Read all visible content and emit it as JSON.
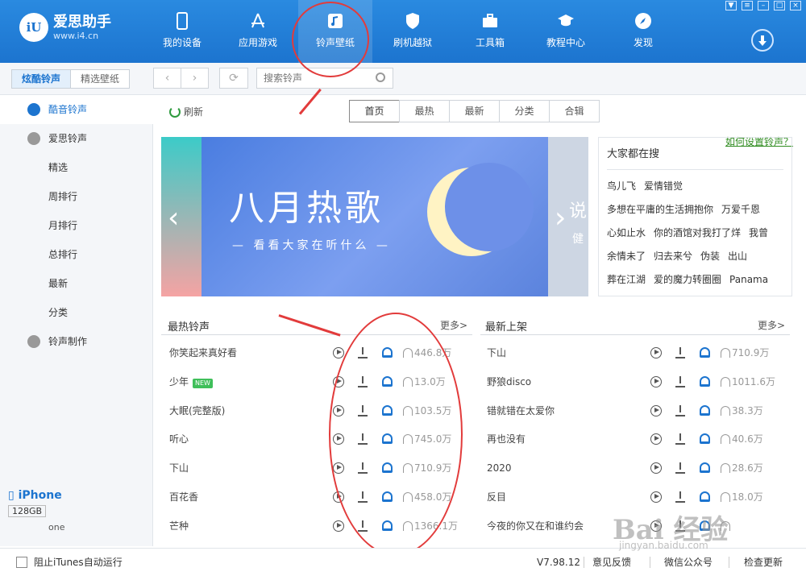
{
  "app": {
    "name": "爱思助手",
    "url": "www.i4.cn",
    "logo_text": "iU"
  },
  "nav": [
    {
      "label": "我的设备",
      "icon": "phone-icon"
    },
    {
      "label": "应用游戏",
      "icon": "app-store-icon"
    },
    {
      "label": "铃声壁纸",
      "icon": "music-note-icon"
    },
    {
      "label": "刷机越狱",
      "icon": "shield-icon"
    },
    {
      "label": "工具箱",
      "icon": "toolbox-icon"
    },
    {
      "label": "教程中心",
      "icon": "graduation-cap-icon"
    },
    {
      "label": "发现",
      "icon": "compass-icon"
    }
  ],
  "nav_active_index": 2,
  "toolbar": {
    "seg_ringtone": "炫酷铃声",
    "seg_wallpaper": "精选壁纸",
    "search_placeholder": "搜索铃声",
    "howto": "如何设置铃声？"
  },
  "sidebar": {
    "items": [
      "酷音铃声",
      "爱思铃声",
      "精选",
      "周排行",
      "月排行",
      "总排行",
      "最新",
      "分类",
      "铃声制作"
    ]
  },
  "device": {
    "name": "iPhone",
    "capacity": "128GB",
    "sub": "one"
  },
  "content": {
    "refresh": "刷新",
    "tabs": [
      "首页",
      "最热",
      "最新",
      "分类",
      "合辑"
    ],
    "banner": {
      "title": "八月热歌",
      "subtitle": "— 看看大家在听什么 —",
      "side_text_1": "说",
      "side_text_2": "健"
    },
    "trending": {
      "title": "大家都在搜",
      "tags": [
        "鸟儿飞",
        "爱情错觉",
        "多想在平庸的生活拥抱你",
        "万爱千恩",
        "心如止水",
        "你的酒馆对我打了烊",
        "我曾",
        "余情未了",
        "归去来兮",
        "伪装",
        "出山",
        "葬在江湖",
        "爱的魔力转圈圈",
        "Panama"
      ]
    }
  },
  "hot": {
    "title": "最热铃声",
    "more": "更多>",
    "rows": [
      {
        "name": "你笑起来真好看",
        "count": "446.8万"
      },
      {
        "name": "少年",
        "count": "13.0万",
        "new": "NEW"
      },
      {
        "name": "大眠(完整版)",
        "count": "103.5万"
      },
      {
        "name": "听心",
        "count": "745.0万"
      },
      {
        "name": "下山",
        "count": "710.9万"
      },
      {
        "name": "百花香",
        "count": "458.0万"
      },
      {
        "name": "芒种",
        "count": "1366.1万"
      }
    ]
  },
  "latest": {
    "title": "最新上架",
    "more": "更多>",
    "rows": [
      {
        "name": "下山",
        "count": "710.9万"
      },
      {
        "name": "野狼disco",
        "count": "1011.6万"
      },
      {
        "name": "错就错在太爱你",
        "count": "38.3万"
      },
      {
        "name": "再也没有",
        "count": "40.6万"
      },
      {
        "name": "2020",
        "count": "28.6万"
      },
      {
        "name": "反目",
        "count": "18.0万"
      },
      {
        "name": "今夜的你又在和谁约会",
        "count": ""
      }
    ]
  },
  "status": {
    "checkbox_label": "阻止iTunes自动运行",
    "version": "V7.98.12",
    "feedback": "意见反馈",
    "wechat": "微信公众号",
    "update": "检查更新"
  },
  "watermark": {
    "main": "Bai 经验",
    "sub": "jingyan.baidu.com"
  },
  "colors": {
    "brand": "#1c74cf",
    "annotation": "#e23b3b",
    "new_tag": "#3fbf5a"
  }
}
